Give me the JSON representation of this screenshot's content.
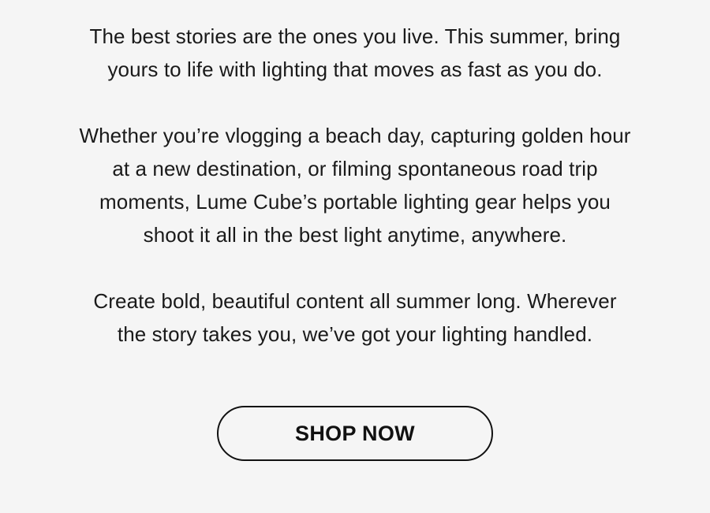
{
  "body_copy": {
    "paragraph_1": [
      "The best stories are the ones you live. This summer, bring",
      "yours to life with lighting that moves as fast as you do."
    ],
    "paragraph_2": [
      "Whether you’re vlogging a beach day, capturing golden hour",
      "at a new destination, or filming spontaneous road trip",
      "moments, Lume Cube’s portable lighting gear helps you",
      "shoot it all in the best light anytime, anywhere."
    ],
    "paragraph_3": [
      "Create bold, beautiful content all summer long. Wherever",
      "the story takes you, we’ve got your lighting handled."
    ]
  },
  "cta": {
    "label": "SHOP NOW"
  },
  "colors": {
    "background": "#f5f5f5",
    "text": "#1a1a1a",
    "button_border": "#111111"
  }
}
